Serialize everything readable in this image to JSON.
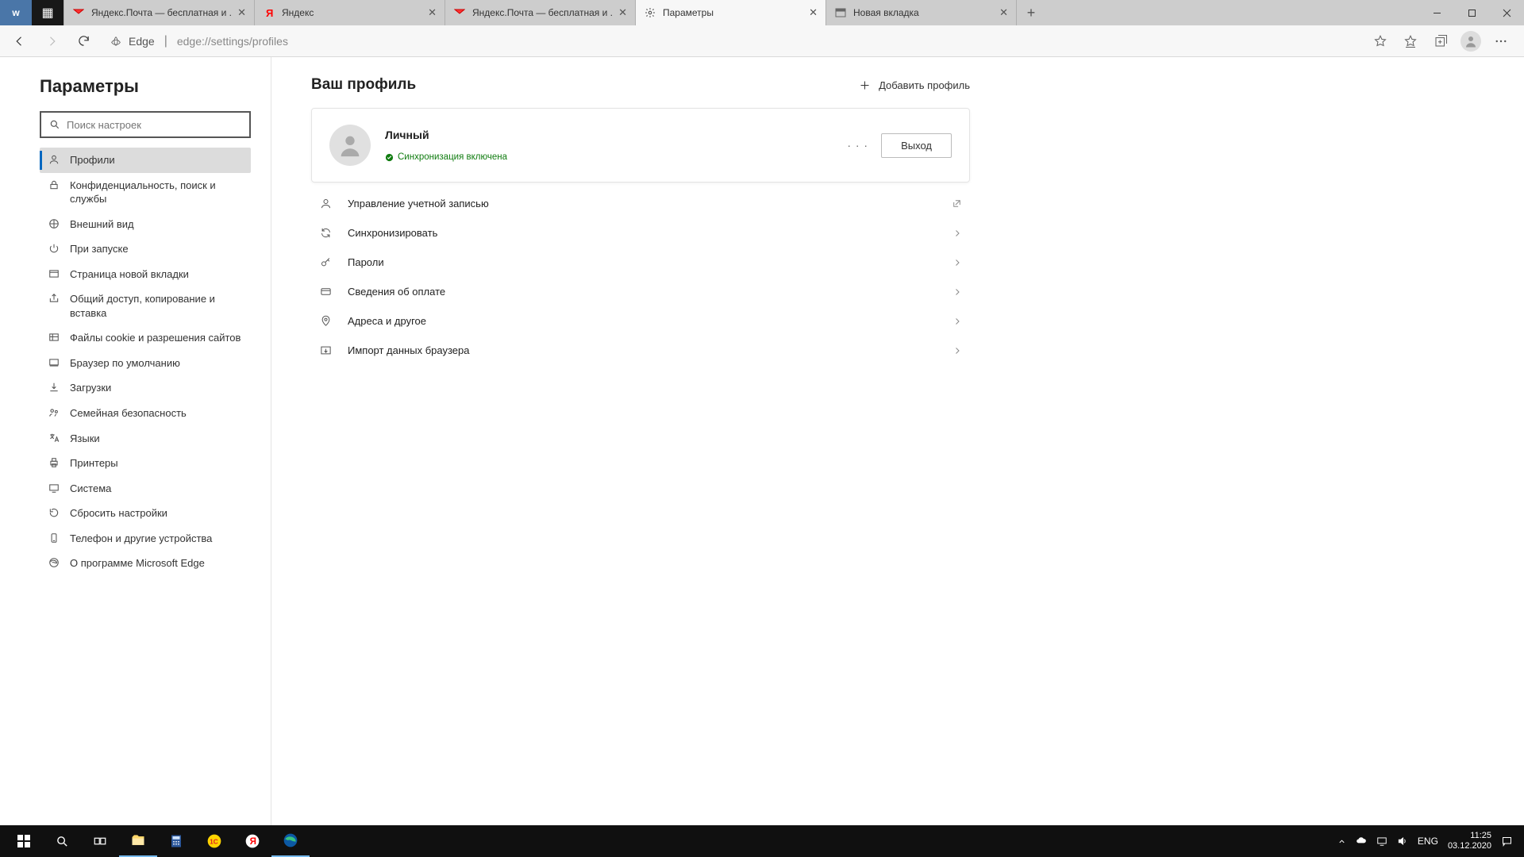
{
  "tabs": {
    "t0_title": "Яндекс.Почта — бесплатная и ...",
    "t1_title": "Яндекс",
    "t2_title": "Яндекс.Почта — бесплатная и ...",
    "t3_title": "Параметры",
    "t4_title": "Новая вкладка"
  },
  "addr": {
    "identity": "Edge",
    "url": "edge://settings/profiles"
  },
  "sidebar": {
    "title": "Параметры",
    "search_placeholder": "Поиск настроек",
    "items": {
      "i0": "Профили",
      "i1": "Конфиденциальность, поиск и службы",
      "i2": "Внешний вид",
      "i3": "При запуске",
      "i4": "Страница новой вкладки",
      "i5": "Общий доступ, копирование и вставка",
      "i6": "Файлы cookie и разрешения сайтов",
      "i7": "Браузер по умолчанию",
      "i8": "Загрузки",
      "i9": "Семейная безопасность",
      "i10": "Языки",
      "i11": "Принтеры",
      "i12": "Система",
      "i13": "Сбросить настройки",
      "i14": "Телефон и другие устройства",
      "i15": "О программе Microsoft Edge"
    }
  },
  "main": {
    "heading": "Ваш профиль",
    "add_profile": "Добавить профиль",
    "profile_name": "Личный",
    "sync_status": "Синхронизация включена",
    "logout": "Выход",
    "options": {
      "o0": "Управление учетной записью",
      "o1": "Синхронизировать",
      "o2": "Пароли",
      "o3": "Сведения об оплате",
      "o4": "Адреса и другое",
      "o5": "Импорт данных браузера"
    }
  },
  "taskbar": {
    "lang": "ENG",
    "time": "11:25",
    "date": "03.12.2020"
  }
}
